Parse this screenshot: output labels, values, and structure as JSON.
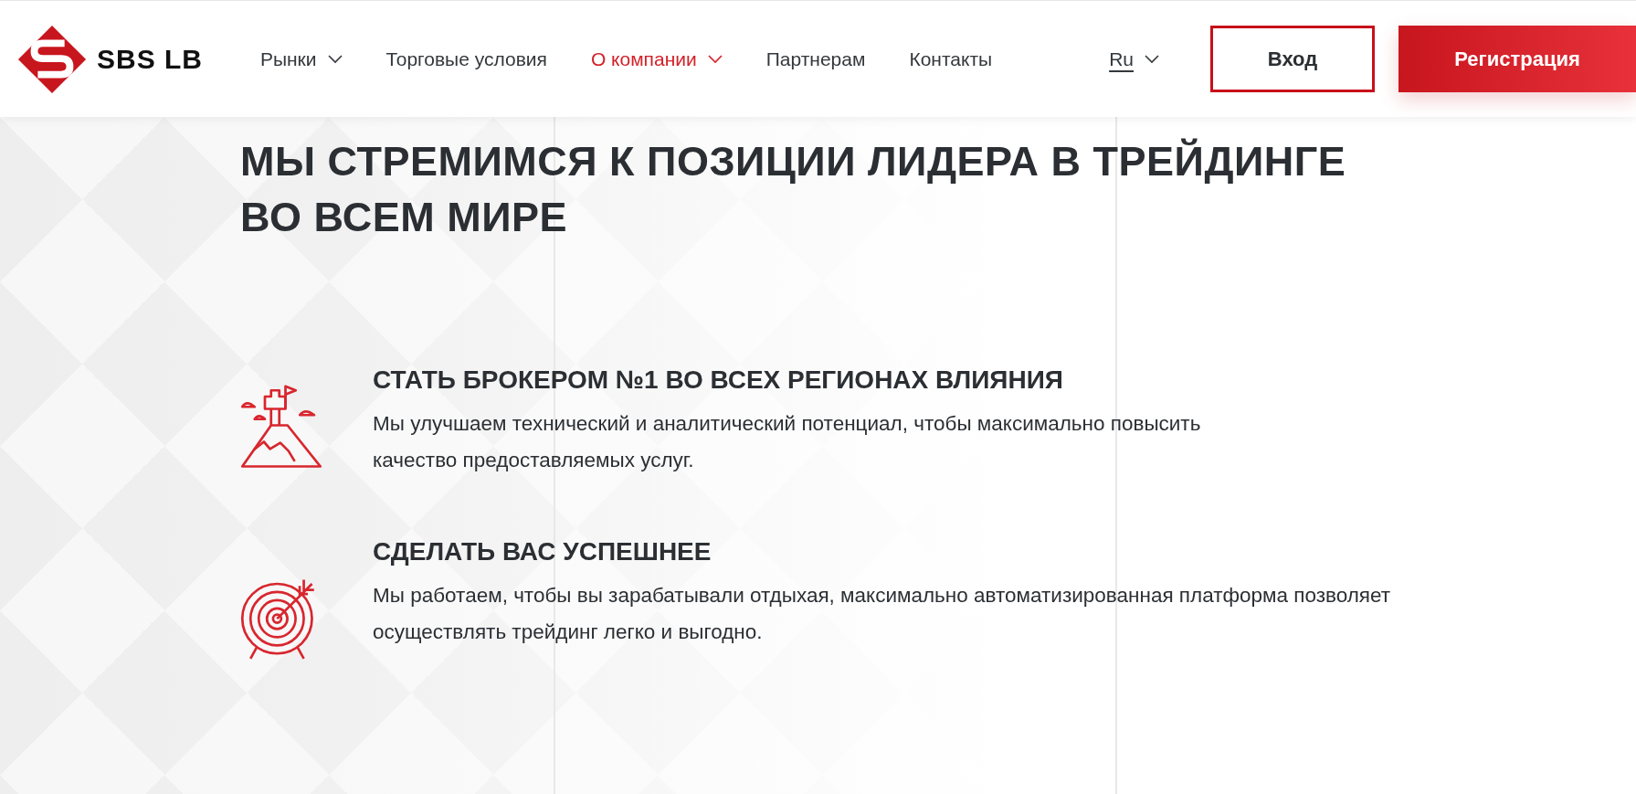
{
  "header": {
    "logo_text": "SBS LB",
    "nav": [
      {
        "label": "Рынки",
        "has_menu": true,
        "selected": false
      },
      {
        "label": "Торговые условия",
        "has_menu": false,
        "selected": false
      },
      {
        "label": "О компании",
        "has_menu": true,
        "selected": true
      },
      {
        "label": "Партнерам",
        "has_menu": false,
        "selected": false
      },
      {
        "label": "Контакты",
        "has_menu": false,
        "selected": false
      }
    ],
    "language": {
      "label": "Ru"
    },
    "buttons": [
      {
        "label": "Вход",
        "kind": "outline"
      },
      {
        "label": "Регистрация",
        "kind": "filled"
      }
    ]
  },
  "section": {
    "title": "МЫ СТРЕМИМСЯ К ПОЗИЦИИ ЛИДЕРА В ТРЕЙДИНГЕ\nВО ВСЕМ МИРЕ",
    "goals": [
      {
        "kind": "mountain",
        "title": "СТАТЬ БРОКЕРОМ №1 ВО ВСЕХ РЕГИОНАХ ВЛИЯНИЯ",
        "description": "Мы улучшаем технический и аналитический потенциал, чтобы максимально повысить\nкачество предоставляемых услуг."
      },
      {
        "kind": "target",
        "title": "СДЕЛАТЬ ВАС УСПЕШНЕЕ",
        "description": "Мы работаем, чтобы вы зарабатывали отдыхая, максимально автоматизированная платформа позволяет\nосуществлять трейдинг легко и выгодно."
      }
    ]
  }
}
